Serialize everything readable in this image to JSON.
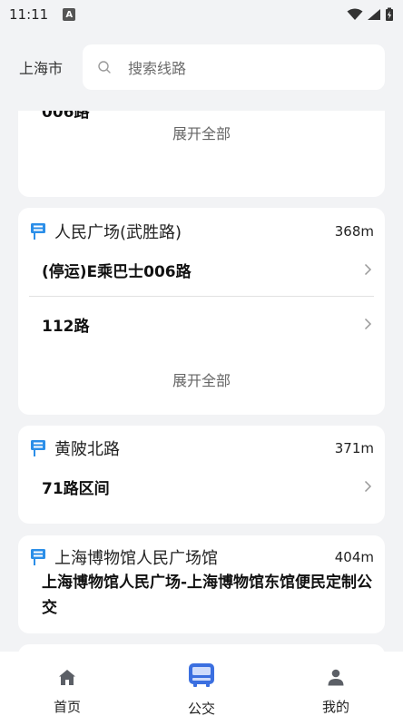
{
  "status_bar": {
    "time": "11:11",
    "notif_letter": "A"
  },
  "header": {
    "city": "上海市",
    "search_placeholder": "搜索线路"
  },
  "partial_card": {
    "top_line_fragment": "006路",
    "expand_label": "展开全部"
  },
  "stops": [
    {
      "name": "人民广场(武胜路)",
      "distance": "368m",
      "lines": [
        "(停运)E乘巴士006路",
        "112路"
      ],
      "expand_label": "展开全部"
    },
    {
      "name": "黄陂北路",
      "distance": "371m",
      "lines": [
        "71路区间"
      ]
    },
    {
      "name": "上海博物馆人民广场馆",
      "distance": "404m",
      "lines": [
        "上海博物馆人民广场-上海博物馆东馆便民定制公交"
      ]
    }
  ],
  "tabs": [
    {
      "label": "首页",
      "icon": "home-icon",
      "active": false
    },
    {
      "label": "公交",
      "icon": "bus-icon",
      "active": true
    },
    {
      "label": "我的",
      "icon": "person-icon",
      "active": false
    }
  ],
  "colors": {
    "accent": "#3b6fe0",
    "stop_icon": "#2b8ee8",
    "icon_gray": "#5b5f66"
  }
}
